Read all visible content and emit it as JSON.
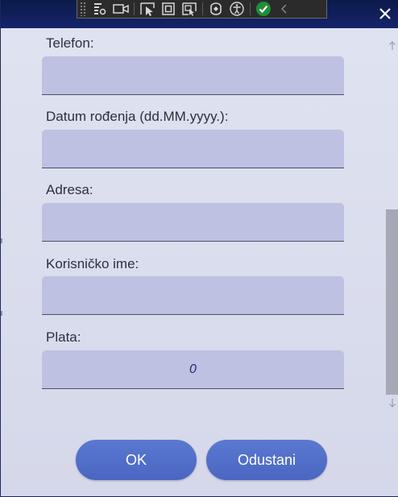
{
  "window": {
    "close_glyph": "✕",
    "accent": "#14246a"
  },
  "devtools": {
    "icons": [
      "live-visual-tree-icon",
      "record-icon",
      "select-element-icon",
      "display-layout-adorners-icon",
      "track-focus-icon",
      "hot-reload-icon",
      "accessibility-icon",
      "accessibility-checker-icon",
      "collapse-icon"
    ]
  },
  "form": {
    "fields": [
      {
        "label": "Telefon:",
        "value": ""
      },
      {
        "label": "Datum rođenja (dd.MM.yyyy.):",
        "value": ""
      },
      {
        "label": "Adresa:",
        "value": ""
      },
      {
        "label": "Korisničko ime:",
        "value": ""
      },
      {
        "label": "Plata:",
        "value": "0"
      }
    ]
  },
  "buttons": {
    "ok": "OK",
    "cancel": "Odustani"
  },
  "scrollbar": {
    "up_glyph": "↑",
    "down_glyph": "↓"
  }
}
